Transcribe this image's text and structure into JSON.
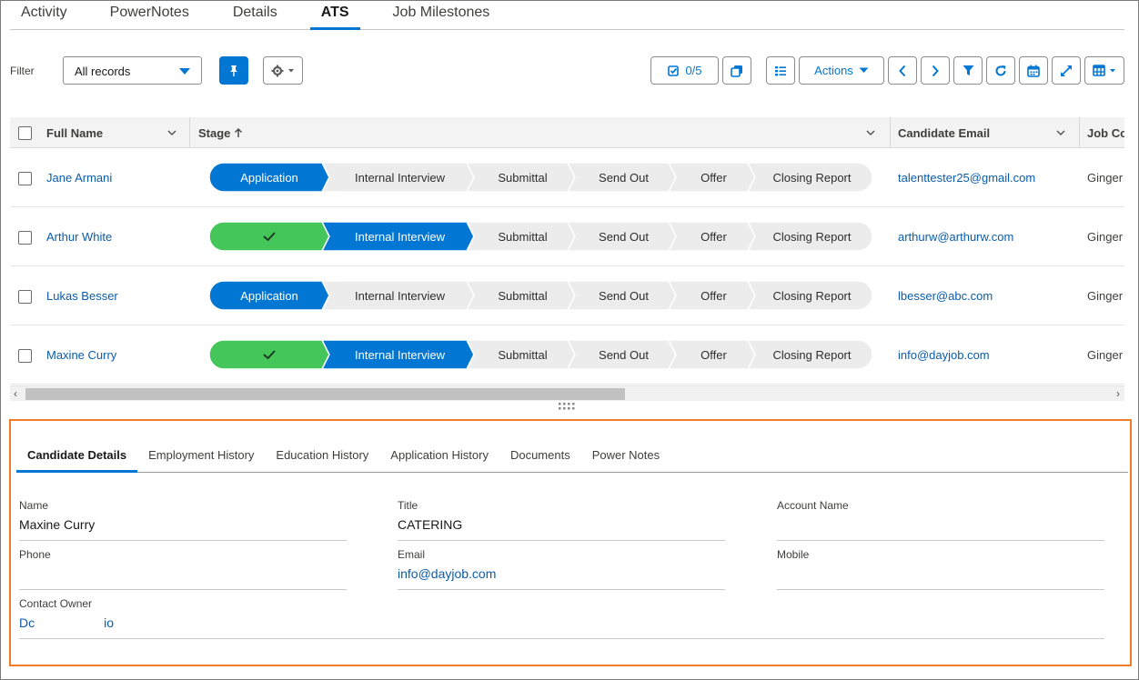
{
  "top_tabs": [
    {
      "label": "Activity"
    },
    {
      "label": "PowerNotes"
    },
    {
      "label": "Details"
    },
    {
      "label": "ATS"
    },
    {
      "label": "Job Milestones"
    }
  ],
  "filter": {
    "label": "Filter",
    "selected": "All records"
  },
  "toolbar": {
    "selected_count": "0/5",
    "actions_label": "Actions"
  },
  "grid": {
    "columns": [
      {
        "label": "Full Name"
      },
      {
        "label": "Stage"
      },
      {
        "label": "Candidate Email"
      },
      {
        "label": "Job Co"
      }
    ],
    "stage_sort_icon": "arrow-up-icon",
    "stages": [
      "Application",
      "Internal Interview",
      "Submittal",
      "Send Out",
      "Offer",
      "Closing Report"
    ],
    "rows": [
      {
        "name": "Jane Armani",
        "current_stage": 0,
        "email": "talenttester25@gmail.com",
        "job": "Ginger"
      },
      {
        "name": "Arthur White",
        "current_stage": 1,
        "email": "arthurw@arthurw.com",
        "job": "Ginger"
      },
      {
        "name": "Lukas Besser",
        "current_stage": 0,
        "email": "lbesser@abc.com",
        "job": "Ginger"
      },
      {
        "name": "Maxine Curry",
        "current_stage": 1,
        "email": "info@dayjob.com",
        "job": "Ginger"
      }
    ]
  },
  "details": {
    "tabs": [
      {
        "label": "Candidate Details"
      },
      {
        "label": "Employment History"
      },
      {
        "label": "Education History"
      },
      {
        "label": "Application History"
      },
      {
        "label": "Documents"
      },
      {
        "label": "Power Notes"
      }
    ],
    "fields": {
      "name": {
        "label": "Name",
        "value": "Maxine Curry"
      },
      "title": {
        "label": "Title",
        "value": "CATERING"
      },
      "account_name": {
        "label": "Account Name",
        "value": ""
      },
      "phone": {
        "label": "Phone",
        "value": ""
      },
      "email": {
        "label": "Email",
        "value": "info@dayjob.com"
      },
      "mobile": {
        "label": "Mobile",
        "value": ""
      },
      "contact_owner": {
        "label": "Contact Owner",
        "value_start": "Dc",
        "value_end": "io"
      }
    }
  },
  "colors": {
    "brand": "#0176d3",
    "complete": "#45c65a",
    "stage_inactive": "#ececec",
    "panel_border": "#ef7d2b"
  }
}
